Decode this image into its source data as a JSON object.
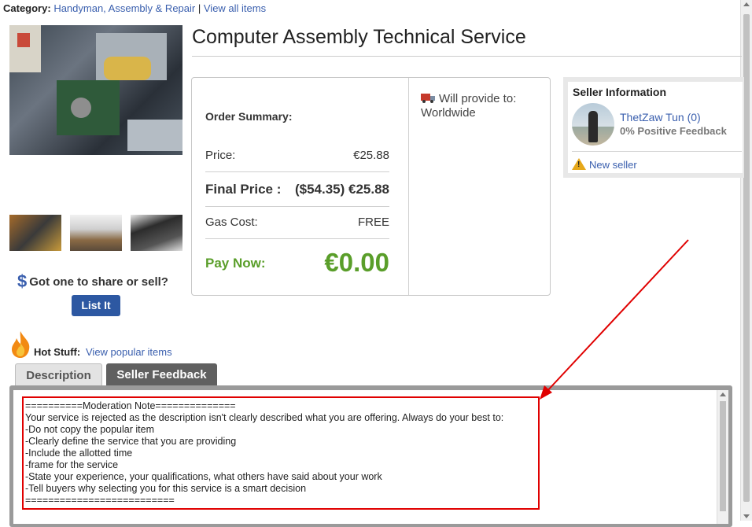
{
  "category": {
    "label": "Category:",
    "link": "Handyman, Assembly & Repair",
    "separator": "|",
    "view_all": "View all items"
  },
  "product": {
    "title": "Computer Assembly Technical Service"
  },
  "order": {
    "summary_label": "Order Summary:",
    "price_label": "Price:",
    "price_value": "€25.88",
    "final_label": "Final Price :",
    "final_value": "($54.35) €25.88",
    "gas_label": "Gas Cost:",
    "gas_value": "FREE",
    "pay_label": "Pay Now:",
    "pay_value": "€0.00"
  },
  "provide": {
    "label": "Will provide to:",
    "value": "Worldwide"
  },
  "seller": {
    "title": "Seller Information",
    "name": "ThetZaw Tun",
    "count": "(0)",
    "feedback": "0% Positive Feedback",
    "status": "New seller"
  },
  "share": {
    "text": "Got one to share or sell?",
    "button": "List It"
  },
  "hot": {
    "label": "Hot Stuff:",
    "link": "View popular items"
  },
  "tabs": {
    "description": "Description",
    "feedback": "Seller Feedback"
  },
  "note": {
    "lines": [
      "==========Moderation Note==============",
      "Your service is rejected as the description isn't clearly described what you are offering. Always do your best to:",
      "-Do not copy the popular item",
      "-Clearly define the service that you are providing",
      "-Include the allotted time",
      "-frame for the service",
      "-State your experience, your qualifications, what others have said about your work",
      "-Tell buyers why selecting you for this service is a smart decision",
      "=========================="
    ]
  },
  "colors": {
    "link": "#3a5fae",
    "pay_green": "#5a9e2a",
    "annotation_red": "#e00000",
    "button_blue": "#2d58a2"
  }
}
